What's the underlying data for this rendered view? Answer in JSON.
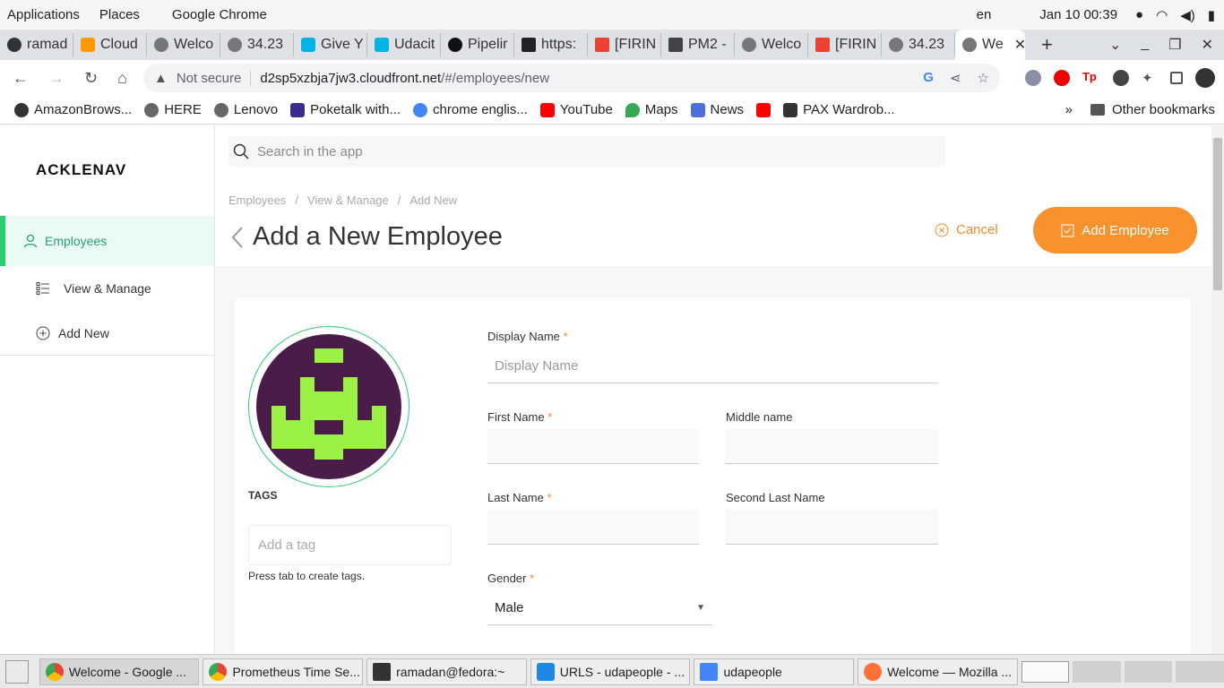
{
  "system": {
    "applications": "Applications",
    "places": "Places",
    "app_name": "Google Chrome",
    "lang": "en",
    "datetime": "Jan 10  00:39"
  },
  "tabs": [
    "ramad",
    "Cloud",
    "Welco",
    "34.23",
    "Give Y",
    "Udacit",
    "Pipelir",
    "https:",
    "[FIRIN",
    "PM2 -",
    "Welco",
    "[FIRIN",
    "34.23",
    "We"
  ],
  "address": {
    "security": "Not secure",
    "host": "d2sp5xzbja7jw3.cloudfront.net",
    "path": "/#/employees/new"
  },
  "bookmarks": [
    "AmazonBrows...",
    "HERE",
    "Lenovo",
    "Poketalk with...",
    "chrome englis...",
    "YouTube",
    "Maps",
    "News",
    "PAX Wardrob..."
  ],
  "other_bookmarks": "Other bookmarks",
  "sidebar": {
    "logo": "ACKLENAV",
    "main": "Employees",
    "view": "View & Manage",
    "add": "Add New"
  },
  "header": {
    "search_placeholder": "Search in the app",
    "breadcrumb": [
      "Employees",
      "/",
      "View & Manage",
      "/",
      "Add New"
    ],
    "title": "Add a New Employee",
    "cancel": "Cancel",
    "add_button": "Add Employee"
  },
  "form": {
    "tags_label": "TAGS",
    "tag_placeholder": "Add a tag",
    "tag_hint": "Press tab to create tags.",
    "display_name": "Display Name",
    "display_name_placeholder": "Display Name",
    "first_name": "First Name",
    "middle_name": "Middle name",
    "last_name": "Last Name",
    "second_last_name": "Second Last Name",
    "gender": "Gender",
    "gender_value": "Male",
    "req": "*"
  },
  "taskbar": [
    "Welcome - Google ...",
    "Prometheus Time Se...",
    "ramadan@fedora:~",
    "URLS - udapeople - ...",
    "udapeople",
    "Welcome — Mozilla ..."
  ],
  "colors": {
    "accent_orange": "#f7922f",
    "accent_green": "#2ecc71",
    "avatar_bg": "#4a1c4a",
    "avatar_fg": "#9cf244"
  }
}
